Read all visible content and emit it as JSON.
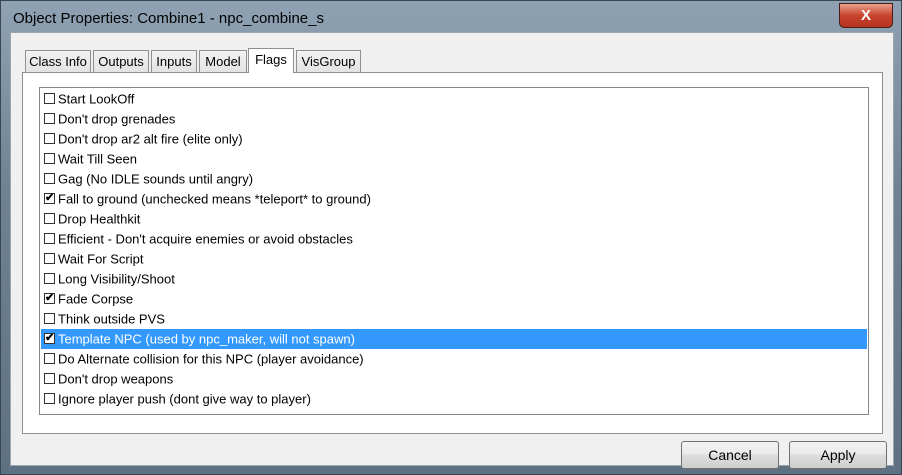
{
  "window": {
    "title": "Object Properties: Combine1 - npc_combine_s",
    "close_glyph": "X"
  },
  "tabs": [
    {
      "label": "Class Info"
    },
    {
      "label": "Outputs"
    },
    {
      "label": "Inputs"
    },
    {
      "label": "Model"
    },
    {
      "label": "Flags"
    },
    {
      "label": "VisGroup"
    }
  ],
  "active_tab": "Flags",
  "flags": [
    {
      "label": "Start LookOff",
      "checked": false
    },
    {
      "label": "Don't drop grenades",
      "checked": false
    },
    {
      "label": "Don't drop ar2 alt fire (elite only)",
      "checked": false
    },
    {
      "label": "Wait Till Seen",
      "checked": false
    },
    {
      "label": "Gag (No IDLE sounds until angry)",
      "checked": false
    },
    {
      "label": "Fall to ground (unchecked means *teleport* to ground)",
      "checked": true
    },
    {
      "label": "Drop Healthkit",
      "checked": false
    },
    {
      "label": "Efficient - Don't acquire enemies or avoid obstacles",
      "checked": false
    },
    {
      "label": "Wait For Script",
      "checked": false
    },
    {
      "label": "Long Visibility/Shoot",
      "checked": false
    },
    {
      "label": "Fade Corpse",
      "checked": true
    },
    {
      "label": "Think outside PVS",
      "checked": false
    },
    {
      "label": "Template NPC (used by npc_maker, will not spawn)",
      "checked": true,
      "selected": true
    },
    {
      "label": "Do Alternate collision for this NPC (player avoidance)",
      "checked": false
    },
    {
      "label": "Don't drop weapons",
      "checked": false
    },
    {
      "label": "Ignore player push (dont give way to player)",
      "checked": false
    }
  ],
  "buttons": {
    "cancel": "Cancel",
    "apply": "Apply"
  },
  "colors": {
    "selection": "#3399ff",
    "close_button": "#c7452f"
  }
}
